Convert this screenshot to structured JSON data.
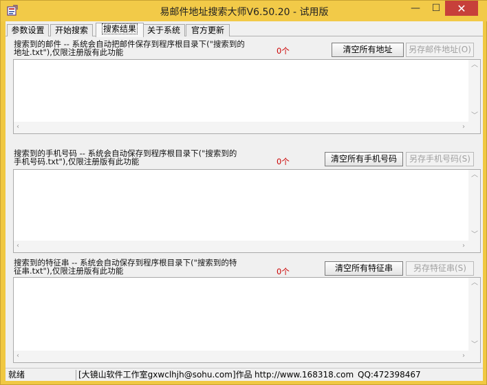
{
  "window": {
    "title": "易邮件地址搜索大师V6.50.20 - 试用版",
    "controls": {
      "minimize": "—",
      "maximize": "☐",
      "close": "✕"
    }
  },
  "tabs": [
    {
      "label": "参数设置"
    },
    {
      "label": "开始搜索"
    },
    {
      "label": "搜索结果",
      "active": true
    },
    {
      "label": "关于系统"
    },
    {
      "label": "官方更新"
    }
  ],
  "email_section": {
    "desc_line1": "搜索到的邮件 -- 系统会自动把邮件保存到程序根目录下(\"搜索到的",
    "desc_line2": "地址.txt\"),仅限注册版有此功能",
    "count": "0个",
    "clear_button": "清空所有地址",
    "save_button": "另存邮件地址(O)"
  },
  "phone_section": {
    "desc_line1": "搜索到的手机号码 -- 系统会自动保存到程序根目录下(\"搜索到的",
    "desc_line2": "手机号码.txt\"),仅限注册版有此功能",
    "count": "0个",
    "clear_button": "清空所有手机号码",
    "save_button": "另存手机号码(S)"
  },
  "feature_section": {
    "desc_line1": "搜索到的特征串 -- 系统会自动保存到程序根目录下(\"搜索到的特",
    "desc_line2": "征串.txt\"),仅限注册版有此功能",
    "count": "0个",
    "clear_button": "清空所有特征串",
    "save_button": "另存特征串(S)"
  },
  "statusbar": {
    "status": "就绪",
    "author": "[大镜山软件工作室gxwclhjh@sohu.com]作品",
    "website": "http://www.168318.com",
    "qq": "QQ:472398467"
  },
  "colors": {
    "titlebar": "#f2ca48",
    "close": "#c7403a",
    "count": "#cc0000"
  }
}
